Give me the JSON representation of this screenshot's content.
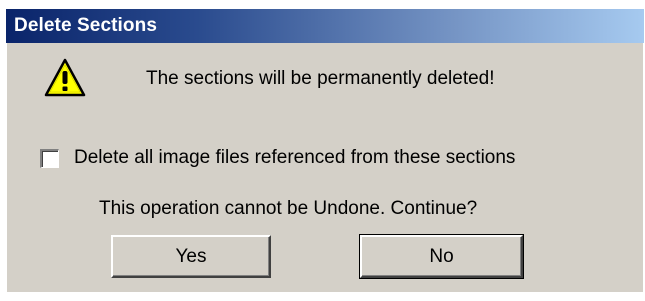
{
  "window": {
    "title": "Delete Sections"
  },
  "dialog": {
    "icon": "warning-triangle-icon",
    "message": "The sections will be permanently deleted!",
    "checkbox": {
      "label": "Delete all image files referenced from these sections",
      "checked": false
    },
    "question": "This operation cannot be Undone. Continue?"
  },
  "buttons": {
    "yes_label": "Yes",
    "no_label": "No"
  },
  "colors": {
    "titlebar_start": "#0a246a",
    "titlebar_end": "#a6caf0",
    "dialog_background": "#d4d0c8",
    "warning_yellow": "#ffff00"
  }
}
